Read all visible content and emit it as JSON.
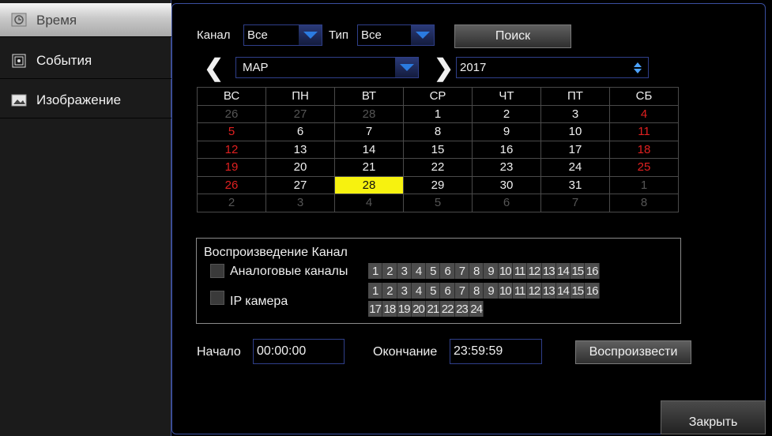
{
  "sidebar": {
    "items": [
      {
        "label": "Время",
        "icon": "clock-icon",
        "active": true
      },
      {
        "label": "События",
        "icon": "event-icon",
        "active": false
      },
      {
        "label": "Изображение",
        "icon": "image-icon",
        "active": false
      }
    ]
  },
  "search": {
    "channel_label": "Канал",
    "channel_value": "Все",
    "type_label": "Тип",
    "type_value": "Все",
    "search_button": "Поиск"
  },
  "date_nav": {
    "prev_glyph": "❮",
    "month": "МАР",
    "next_glyph": "❯",
    "year": "2017"
  },
  "calendar": {
    "weekdays": [
      "ВС",
      "ПН",
      "ВТ",
      "СР",
      "ЧТ",
      "ПТ",
      "СБ"
    ],
    "weeks": [
      [
        "26",
        "27",
        "28",
        "1",
        "2",
        "3",
        "4"
      ],
      [
        "5",
        "6",
        "7",
        "8",
        "9",
        "10",
        "11"
      ],
      [
        "12",
        "13",
        "14",
        "15",
        "16",
        "17",
        "18"
      ],
      [
        "19",
        "20",
        "21",
        "22",
        "23",
        "24",
        "25"
      ],
      [
        "26",
        "27",
        "28",
        "29",
        "30",
        "31",
        "1"
      ],
      [
        "2",
        "3",
        "4",
        "5",
        "6",
        "7",
        "8"
      ]
    ],
    "selected_day": "28"
  },
  "playback": {
    "title": "Воспроизведение Канал",
    "analog_label": "Аналоговые каналы",
    "ip_label": "IP камера",
    "analog_channels": [
      "1",
      "2",
      "3",
      "4",
      "5",
      "6",
      "7",
      "8",
      "9",
      "10",
      "11",
      "12",
      "13",
      "14",
      "15",
      "16"
    ],
    "ip_channels_row1": [
      "1",
      "2",
      "3",
      "4",
      "5",
      "6",
      "7",
      "8",
      "9",
      "10",
      "11",
      "12",
      "13",
      "14",
      "15",
      "16"
    ],
    "ip_channels_row2": [
      "17",
      "18",
      "19",
      "20",
      "21",
      "22",
      "23",
      "24"
    ]
  },
  "time": {
    "start_label": "Начало",
    "start_value": "00:00:00",
    "end_label": "Окончание",
    "end_value": "23:59:59",
    "play_button": "Воспроизвести"
  },
  "footer": {
    "close_button": "Закрыть"
  },
  "colors": {
    "accent_blue": "#2b7be0",
    "weekend_red": "#e02020",
    "selected_yellow": "#f7f20f"
  }
}
